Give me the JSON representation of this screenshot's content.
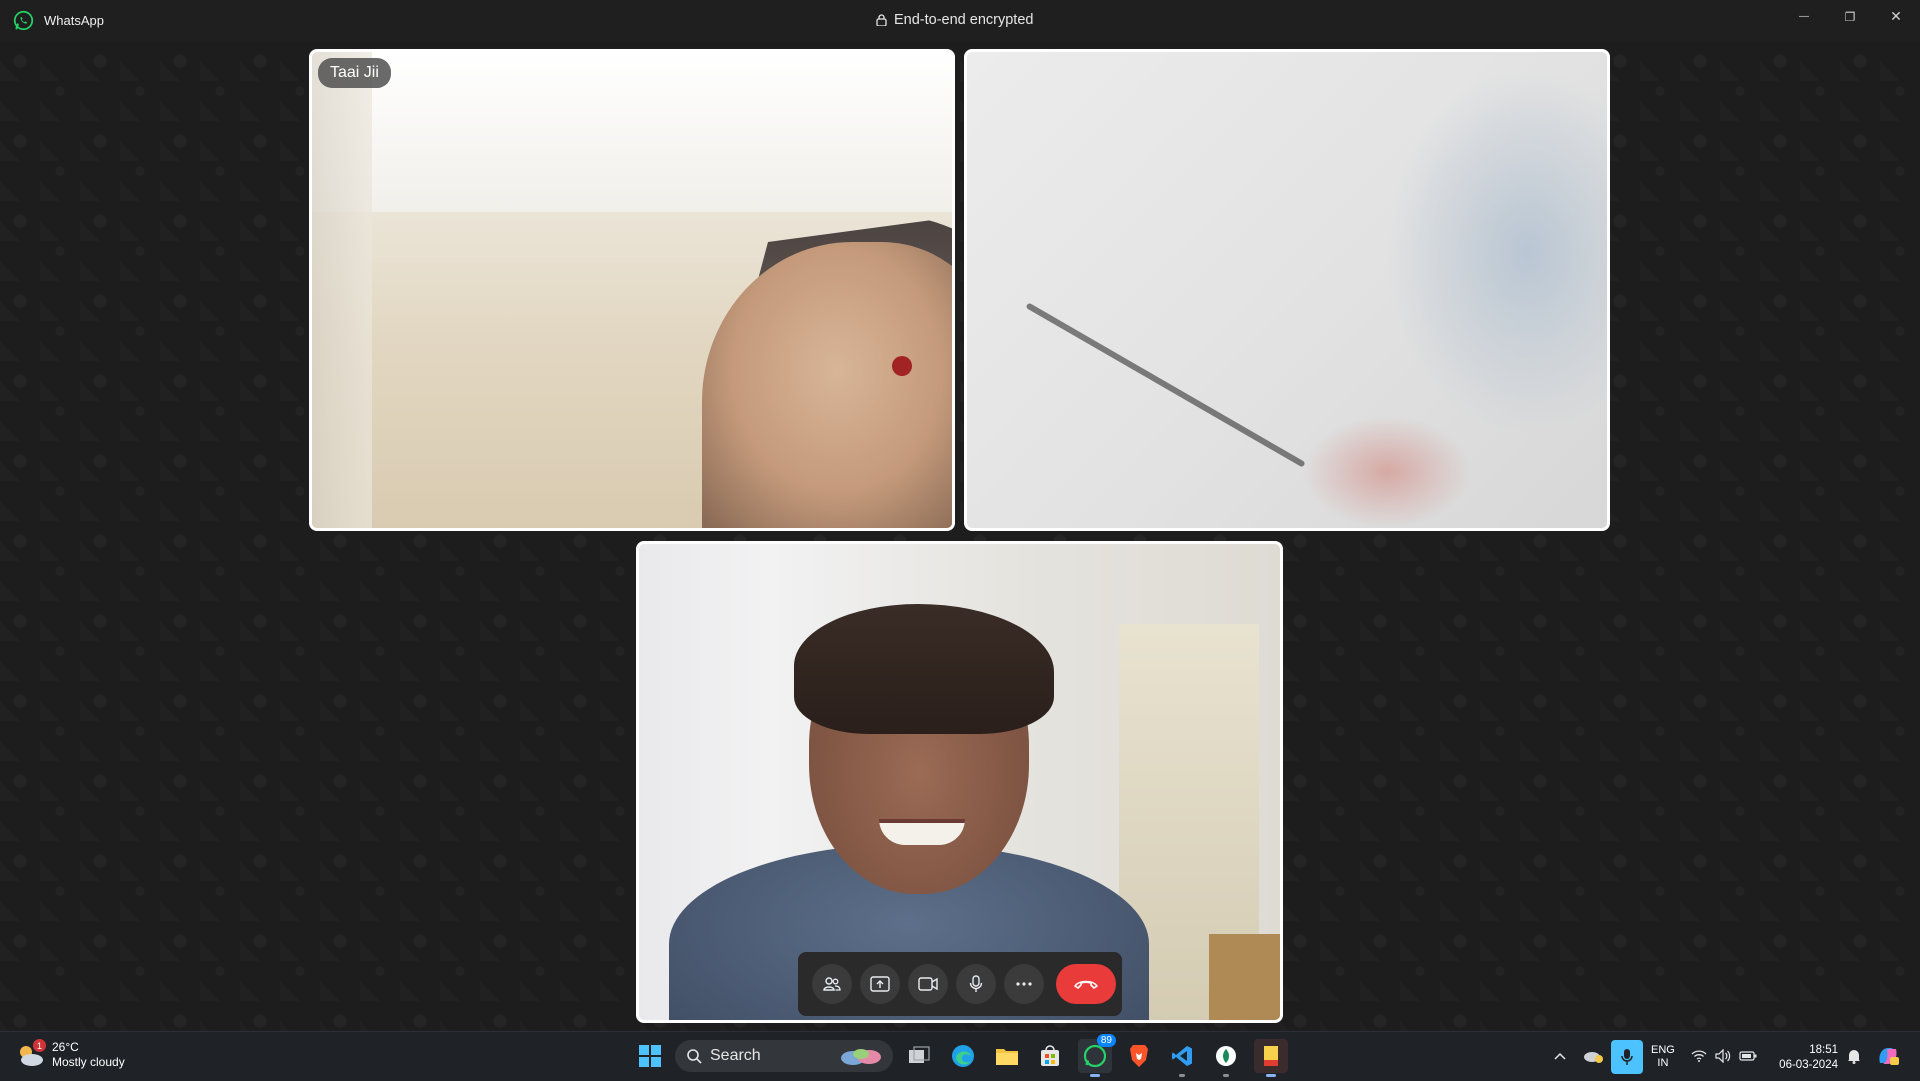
{
  "app": {
    "name": "WhatsApp",
    "encryption_label": "End-to-end encrypted"
  },
  "window_controls": {
    "minimize": "—",
    "restore": "❐",
    "close": "✕"
  },
  "participants": [
    {
      "name": "Taai Jii"
    }
  ],
  "controls": {
    "items": [
      "participants-icon",
      "share-screen-icon",
      "camera-icon",
      "microphone-icon",
      "more-options-icon",
      "end-call-icon"
    ],
    "end_call_color": "#ea3b3b"
  },
  "taskbar": {
    "weather": {
      "temp": "26°C",
      "condition": "Mostly cloudy",
      "badge": "1"
    },
    "search_label": "Search",
    "whatsapp_badge": "89",
    "language": {
      "line1": "ENG",
      "line2": "IN"
    },
    "clock": {
      "time": "18:51",
      "date": "06-03-2024"
    }
  }
}
